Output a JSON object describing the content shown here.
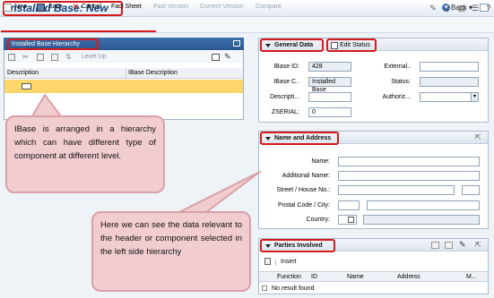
{
  "header": {
    "title": "Installed Base: New",
    "back_label": "Back"
  },
  "toolbar": {
    "new": "New",
    "save": "Save",
    "cancel": "Cancel",
    "fact_sheet": "Fact Sheet",
    "past_version": "Past Version",
    "current_version": "Current Version",
    "compare": "Compare"
  },
  "hierarchy": {
    "title": "Installed Base Hierarchy",
    "level_up": "Level Up",
    "columns": [
      "Description",
      "IBase Description"
    ]
  },
  "general_data": {
    "title": "General Data",
    "edit_status": "Edit Status",
    "ibase_id_label": "IBase ID:",
    "ibase_id_value": "428",
    "ibase_c_label": "IBase C..",
    "ibase_c_value": "Installed Base",
    "descr_label": "Descripti...",
    "zserial_label": "ZSERIAL:",
    "zserial_value": "0",
    "external_label": "External..",
    "status_label": "Status:",
    "authoriz_label": "Authoriz..."
  },
  "name_address": {
    "title": "Name and Address",
    "name_label": "Name:",
    "additional_label": "Additional Name:",
    "street_label": "Street / House No.:",
    "postal_label": "Postal Code / City:",
    "country_label": "Country:"
  },
  "parties": {
    "title": "Parties Involved",
    "insert": "Insert",
    "columns": [
      "Function",
      "ID",
      "Name",
      "Address",
      "M..."
    ],
    "empty": "No result found"
  },
  "callouts": {
    "left": "IBase is arranged in a hierarchy which can have different type of component at different level.",
    "right": "Here we can see the data relevant to the header or component selected in the left side hierarchy"
  },
  "colors": {
    "highlight": "#d51a1a",
    "panel_header": "#2a5792",
    "selected_row": "#fcd66a",
    "callout": "#f2cdd0"
  }
}
